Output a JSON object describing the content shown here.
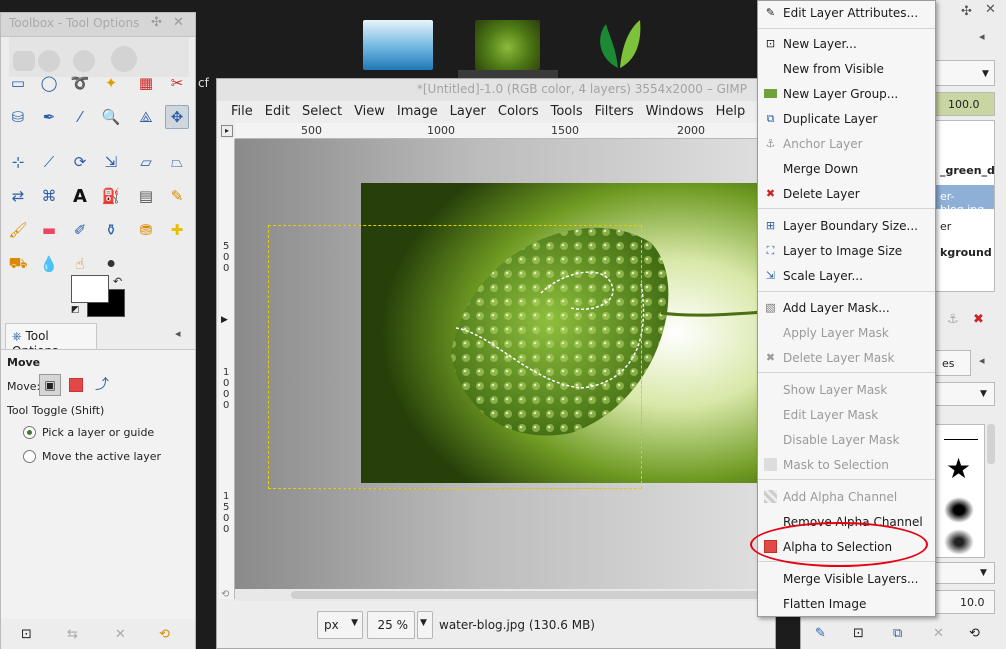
{
  "toolbox": {
    "title": "Toolbox - Tool Options",
    "tool_options_tab": "Tool Options",
    "section_title": "Move",
    "move_label": "Move:",
    "tool_toggle": "Tool Toggle  (Shift)",
    "option_pick": "Pick a layer or guide",
    "option_move_active": "Move the active layer"
  },
  "main_window": {
    "title": "*[Untitled]-1.0 (RGB color, 4 layers) 3554x2000 – GIMP",
    "partial_left_text": "cf",
    "menu": [
      "File",
      "Edit",
      "Select",
      "View",
      "Image",
      "Layer",
      "Colors",
      "Tools",
      "Filters",
      "Windows",
      "Help"
    ],
    "ruler_top": [
      "500",
      "1000",
      "1500",
      "2000"
    ],
    "ruler_left": [
      "5\n0\n0",
      "1\n0\n0\n0",
      "1\n5\n0\n0"
    ],
    "unit": "px",
    "zoom": "25 %",
    "status": "water-blog.jpg (130.6 MB)"
  },
  "right_dock": {
    "opacity": "100.0",
    "layer1": "_green_dro",
    "layer2": "er-blog.jpg",
    "layer3": "er",
    "layer4": "kground",
    "tab_partial": "es",
    "size": "10.0"
  },
  "context_menu": {
    "items": [
      {
        "label": "Edit Layer Attributes...",
        "disabled": false,
        "icon": "edit-icon"
      },
      {
        "label": "New Layer...",
        "disabled": false,
        "icon": "new-layer-icon"
      },
      {
        "label": "New from Visible",
        "disabled": false,
        "icon": ""
      },
      {
        "label": "New Layer Group...",
        "disabled": false,
        "icon": "folder-icon"
      },
      {
        "label": "Duplicate Layer",
        "disabled": false,
        "icon": "duplicate-icon"
      },
      {
        "label": "Anchor Layer",
        "disabled": true,
        "icon": "anchor-icon"
      },
      {
        "label": "Merge Down",
        "disabled": false,
        "icon": ""
      },
      {
        "label": "Delete Layer",
        "disabled": false,
        "icon": "delete-icon"
      },
      {
        "label": "Layer Boundary Size...",
        "disabled": false,
        "icon": "boundary-icon"
      },
      {
        "label": "Layer to Image Size",
        "disabled": false,
        "icon": "fit-icon"
      },
      {
        "label": "Scale Layer...",
        "disabled": false,
        "icon": "scale-icon"
      },
      {
        "label": "Add Layer Mask...",
        "disabled": false,
        "icon": "mask-icon"
      },
      {
        "label": "Apply Layer Mask",
        "disabled": true,
        "icon": ""
      },
      {
        "label": "Delete Layer Mask",
        "disabled": true,
        "icon": "delete-icon"
      },
      {
        "label": "Show Layer Mask",
        "disabled": true,
        "icon": ""
      },
      {
        "label": "Edit Layer Mask",
        "disabled": true,
        "icon": ""
      },
      {
        "label": "Disable Layer Mask",
        "disabled": true,
        "icon": ""
      },
      {
        "label": "Mask to Selection",
        "disabled": true,
        "icon": "mask-sel-icon"
      },
      {
        "label": "Add Alpha Channel",
        "disabled": true,
        "icon": "alpha-icon"
      },
      {
        "label": "Remove Alpha Channel",
        "disabled": false,
        "icon": ""
      },
      {
        "label": "Alpha to Selection",
        "disabled": false,
        "icon": "alpha-selection-icon"
      },
      {
        "label": "Merge Visible Layers...",
        "disabled": false,
        "icon": ""
      },
      {
        "label": "Flatten Image",
        "disabled": false,
        "icon": ""
      }
    ]
  },
  "colors": {
    "highlight_circle": "#e60012",
    "leaf_green": "#5c8a1e"
  }
}
